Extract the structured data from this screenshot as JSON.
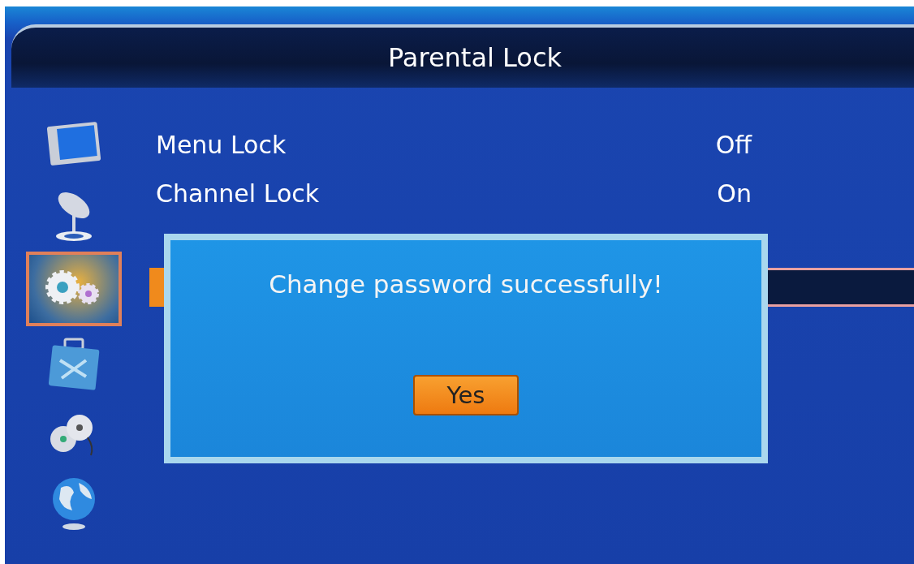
{
  "title": "Parental Lock",
  "sidebar": [
    {
      "kind": "tv",
      "selected": false
    },
    {
      "kind": "satellite",
      "selected": false
    },
    {
      "kind": "gears",
      "selected": true
    },
    {
      "kind": "toolbox",
      "selected": false
    },
    {
      "kind": "film",
      "selected": false
    },
    {
      "kind": "globe",
      "selected": false
    }
  ],
  "menu_items": [
    {
      "label": "Menu Lock",
      "value": "Off"
    },
    {
      "label": "Channel Lock",
      "value": "On"
    }
  ],
  "dialog": {
    "message": "Change password successfully!",
    "button": "Yes"
  }
}
